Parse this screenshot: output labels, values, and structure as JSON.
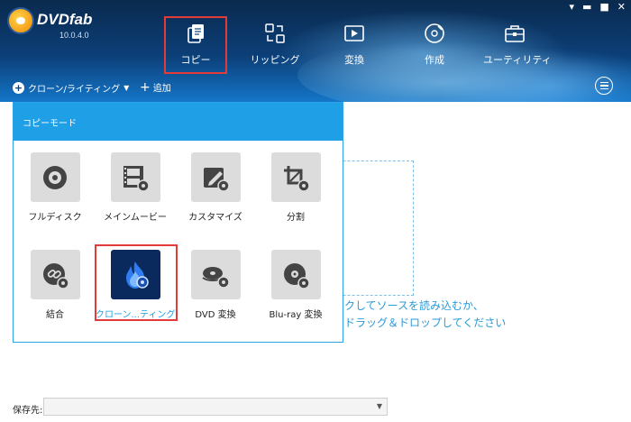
{
  "app": {
    "name": "DVDfab",
    "version": "10.0.4.0"
  },
  "window_controls": [
    "▾",
    "▬",
    "■",
    "✕"
  ],
  "nav": {
    "items": [
      {
        "label": "コピー",
        "icon": "copy-document-icon",
        "active": true
      },
      {
        "label": "リッピング",
        "icon": "ripping-arrows-icon",
        "active": false
      },
      {
        "label": "変換",
        "icon": "film-convert-icon",
        "active": false
      },
      {
        "label": "作成",
        "icon": "disc-create-icon",
        "active": false
      },
      {
        "label": "ユーティリティ",
        "icon": "toolbox-icon",
        "active": false
      }
    ]
  },
  "toolbar": {
    "clone_label": "クローン/ライティング",
    "add_label": "追加"
  },
  "panel": {
    "title": "コピーモード",
    "tiles": [
      {
        "label": "フルディスク",
        "icon": "full-disc-icon"
      },
      {
        "label": "メインムービー",
        "icon": "main-movie-icon"
      },
      {
        "label": "カスタマイズ",
        "icon": "customize-pencil-icon"
      },
      {
        "label": "分割",
        "icon": "split-crop-icon"
      },
      {
        "label": "結合",
        "icon": "merge-link-icon"
      },
      {
        "label": "クローン...ティング",
        "icon": "clone-flame-icon",
        "selected": true
      },
      {
        "label": "DVD 変換",
        "icon": "dvd-convert-icon"
      },
      {
        "label": "Blu-ray 変換",
        "icon": "bluray-convert-icon"
      }
    ]
  },
  "main": {
    "hint_line1": "ックしてソースを読み込むか、",
    "hint_line2": "にドラッグ＆ドロップしてください"
  },
  "footer": {
    "save_label": "保存先:",
    "save_value": ""
  },
  "colors": {
    "accent": "#1f9fe6",
    "highlight": "#e33a3a",
    "header_dark": "#0a2a4e"
  }
}
